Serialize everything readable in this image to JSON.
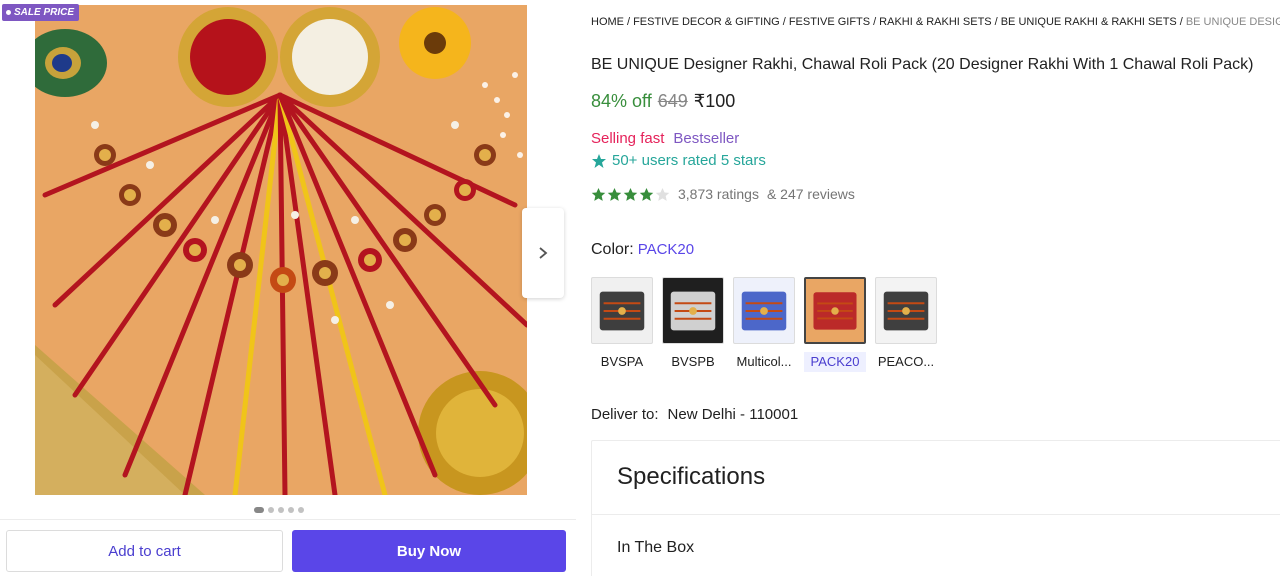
{
  "gallery": {
    "badge": "SALE PRICE",
    "dots_total": 5,
    "dots_active": 1,
    "next_icon": "chevron-right-icon"
  },
  "actions": {
    "add_to_cart": "Add to cart",
    "buy_now": "Buy Now"
  },
  "breadcrumb": [
    "HOME",
    "FESTIVE DECOR & GIFTING",
    "FESTIVE GIFTS",
    "RAKHI & RAKHI SETS",
    "BE UNIQUE RAKHI & RAKHI SETS",
    "BE UNIQUE DESIGNER RAKHI,"
  ],
  "product": {
    "title": "BE UNIQUE Designer Rakhi, Chawal Roli Pack (20 Designer Rakhi With 1 Chawal Roli Pack)",
    "discount": "84% off",
    "mrp": "649",
    "price": "₹100",
    "selling_fast": "Selling fast",
    "bestseller": "Bestseller",
    "users_rated": "50+ users rated 5 stars",
    "rating_value": 4,
    "rating_max": 5,
    "ratings_count": "3,873 ratings",
    "reviews_count": "& 247 reviews"
  },
  "color": {
    "label": "Color:",
    "value": "PACK20",
    "options": [
      {
        "label": "BVSPA",
        "selected": false
      },
      {
        "label": "BVSPB",
        "selected": false
      },
      {
        "label": "Multicol...",
        "selected": false
      },
      {
        "label": "PACK20",
        "selected": true
      },
      {
        "label": "PEACO...",
        "selected": false
      }
    ]
  },
  "delivery": {
    "label": "Deliver to:",
    "location": "New Delhi - 110001"
  },
  "specifications": {
    "title": "Specifications",
    "first_section": "In The Box"
  },
  "colors": {
    "accent": "#5a46e8",
    "discount_green": "#388e3c",
    "selling_fast": "#e5225a",
    "bestseller": "#7e57c2",
    "rated_teal": "#26a69a",
    "star_green": "#388e3c"
  }
}
